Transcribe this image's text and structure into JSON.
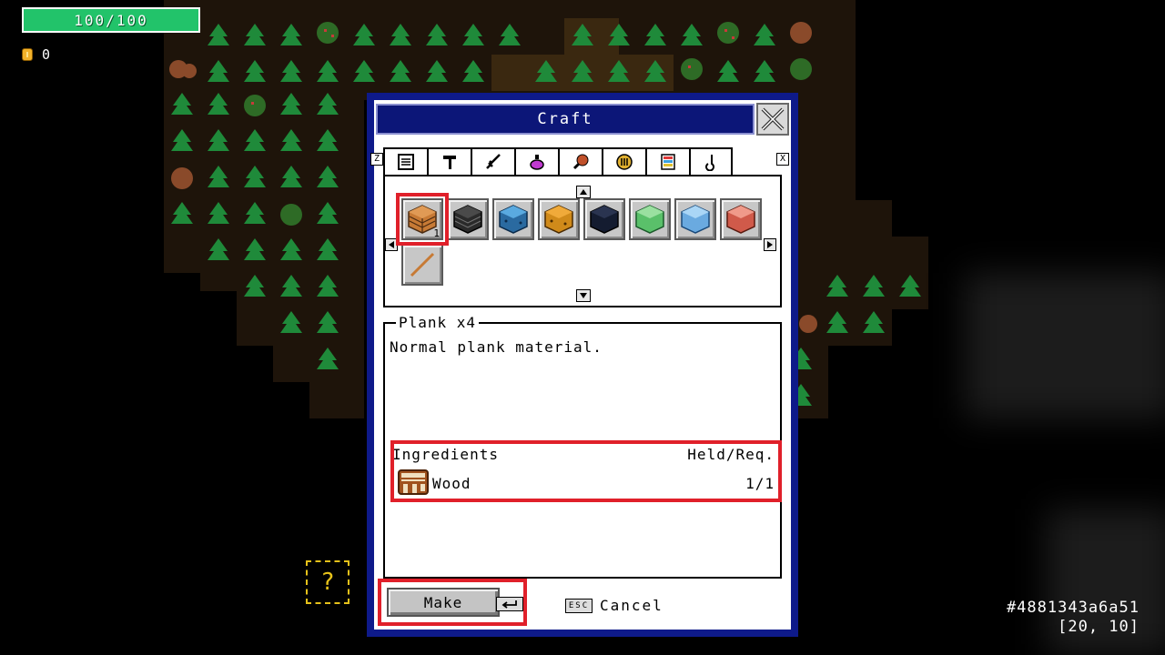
{
  "hud": {
    "health": "100/100",
    "coins": "0",
    "seed": "#4881343a6a51",
    "coords": "[20, 10]"
  },
  "craft": {
    "title": "Craft",
    "tab_prev_key": "Z",
    "tab_next_key": "X",
    "tabs": [
      {
        "name": "blocks-tab-icon"
      },
      {
        "name": "tools-tab-icon"
      },
      {
        "name": "weapons-tab-icon"
      },
      {
        "name": "potions-tab-icon"
      },
      {
        "name": "food-tab-icon"
      },
      {
        "name": "misc-tab-icon"
      },
      {
        "name": "books-tab-icon"
      },
      {
        "name": "hooks-tab-icon"
      }
    ],
    "selected_qty": "1",
    "item": {
      "title": "Plank x4",
      "description": "Normal plank material."
    },
    "ingredients_header": "Ingredients",
    "held_req_header": "Held/Req.",
    "ingredients": [
      {
        "name": "Wood",
        "count": "1/1"
      }
    ],
    "make_label": "Make",
    "esc_label": "ESC",
    "cancel_label": "Cancel"
  }
}
